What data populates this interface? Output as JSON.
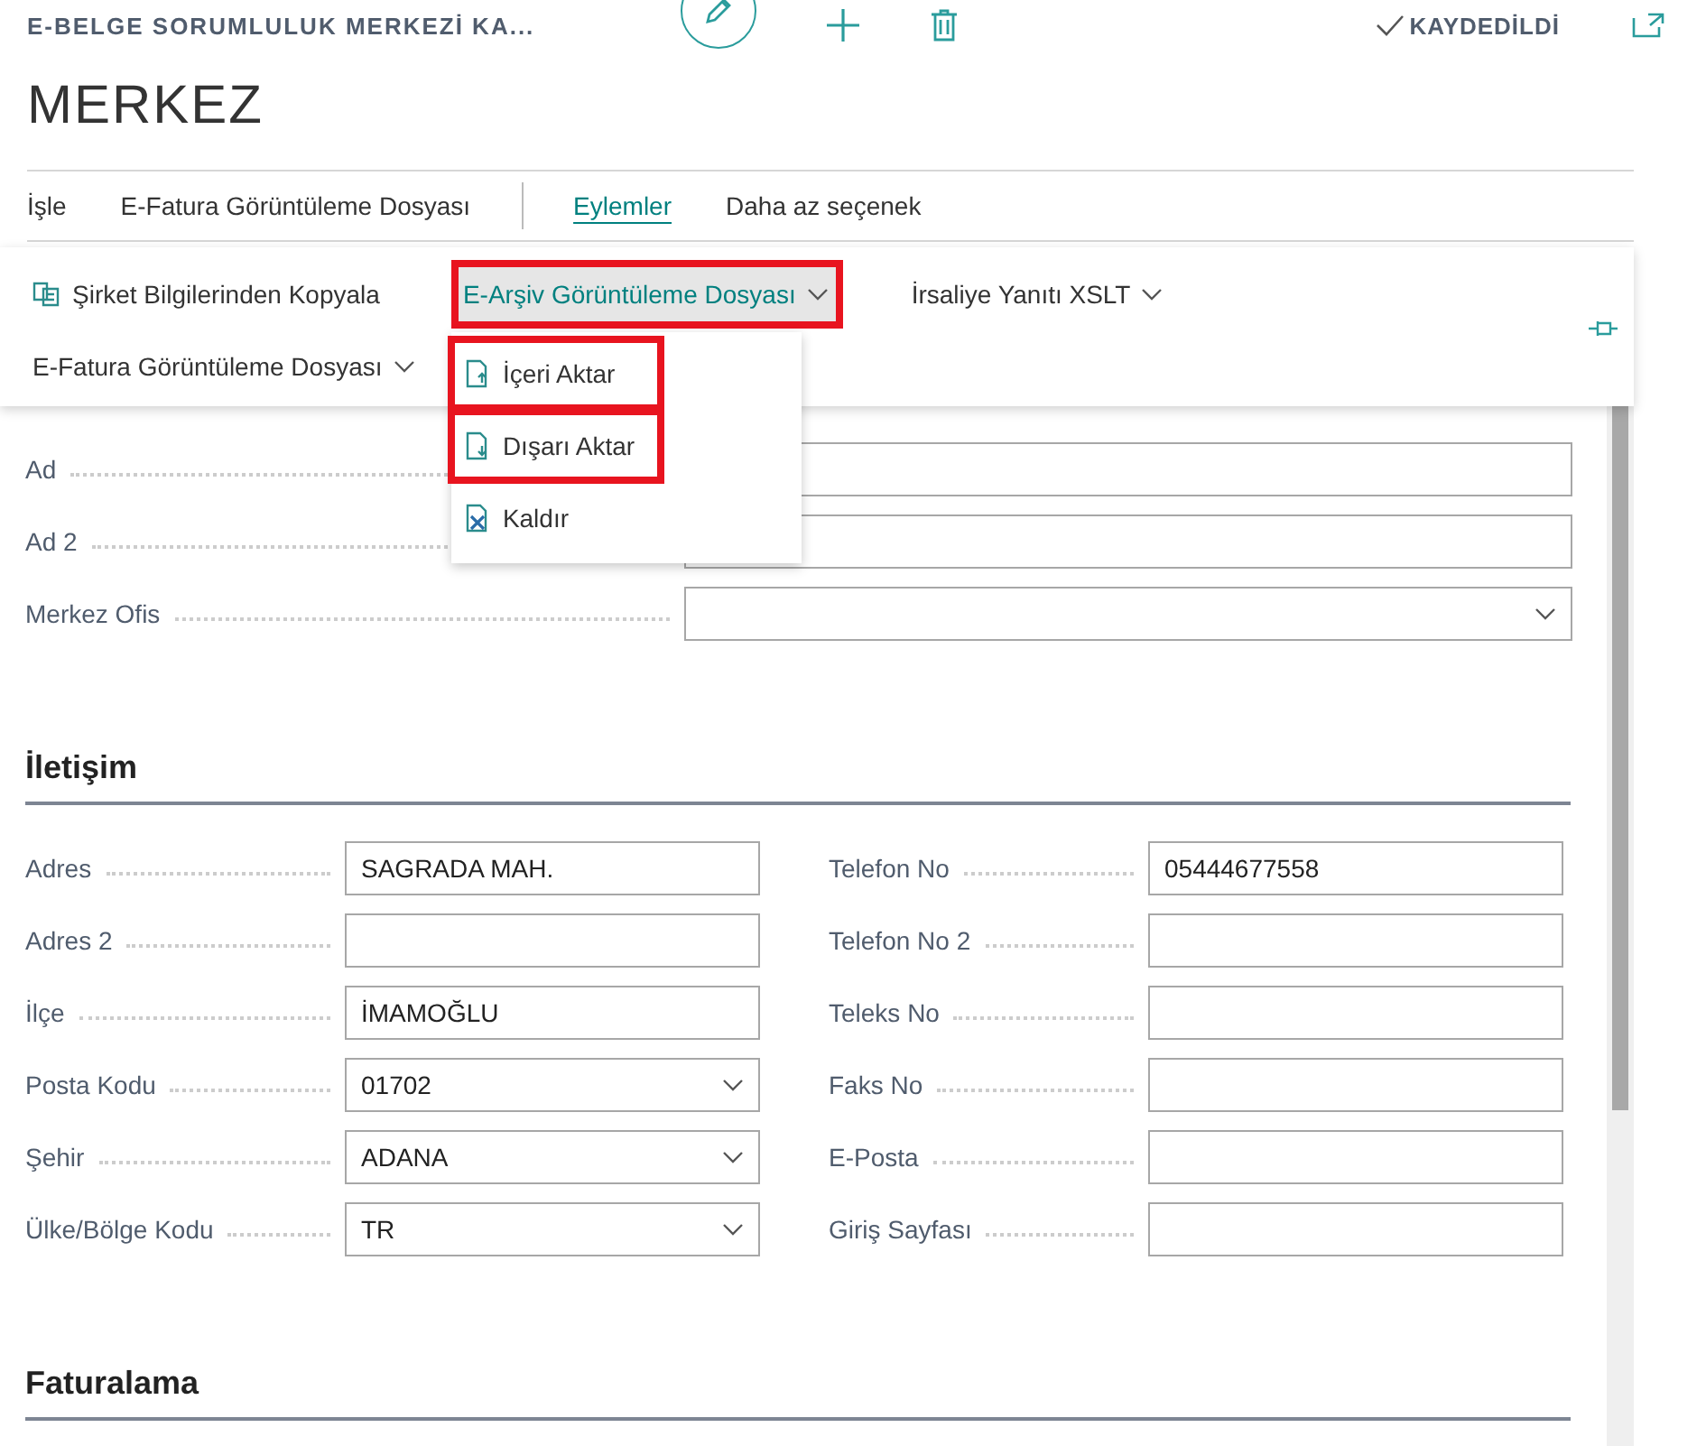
{
  "header": {
    "breadcrumb": "E-BELGE SORUMLULUK MERKEZİ KA...",
    "status": "KAYDEDİLDİ",
    "title": "MERKEZ"
  },
  "promoted_tabs": [
    {
      "label": "İşle",
      "selected": false
    },
    {
      "label": "E-Fatura Görüntüleme Dosyası",
      "selected": false
    }
  ],
  "menu_tabs": [
    {
      "label": "Eylemler",
      "selected": true
    },
    {
      "label": "Daha az seçenek",
      "selected": false
    }
  ],
  "action_rows": [
    [
      {
        "label": "Şirket Bilgilerinden Kopyala",
        "kind": "button",
        "highlighted": false,
        "expanded": false
      },
      {
        "label": "E-Arşiv Görüntüleme Dosyası",
        "kind": "dropdown",
        "highlighted": true,
        "expanded": true
      },
      {
        "label": "İrsaliye Yanıtı XSLT",
        "kind": "dropdown",
        "highlighted": false,
        "expanded": false
      }
    ],
    [
      {
        "label": "E-Fatura Görüntüleme Dosyası",
        "kind": "dropdown",
        "highlighted": false,
        "expanded": false
      }
    ]
  ],
  "dropdown_menu": [
    {
      "label": "İçeri Aktar",
      "kind": "import",
      "highlighted": true
    },
    {
      "label": "Dışarı Aktar",
      "kind": "export",
      "highlighted": true
    },
    {
      "label": "Kaldır",
      "kind": "remove",
      "highlighted": false
    }
  ],
  "general_fields": [
    {
      "label": "Ad",
      "kind": "text"
    },
    {
      "label": "Ad 2",
      "kind": "text"
    },
    {
      "label": "Merkez Ofis",
      "kind": "dropdown"
    }
  ],
  "sections": [
    {
      "title": "İletişim",
      "columns": [
        [
          {
            "label": "Adres",
            "kind": "text",
            "value": "SAGRADA MAH."
          },
          {
            "label": "Adres 2",
            "kind": "text"
          },
          {
            "label": "İlçe",
            "kind": "text",
            "value": "İMAMOĞLU"
          },
          {
            "label": "Posta Kodu",
            "kind": "dropdown",
            "value": "01702"
          },
          {
            "label": "Şehir",
            "kind": "dropdown",
            "value": "ADANA"
          },
          {
            "label": "Ülke/Bölge Kodu",
            "kind": "dropdown",
            "value": "TR"
          }
        ],
        [
          {
            "label": "Telefon No",
            "kind": "text",
            "value": "05444677558"
          },
          {
            "label": "Telefon No 2",
            "kind": "text"
          },
          {
            "label": "Teleks No",
            "kind": "text"
          },
          {
            "label": "Faks No",
            "kind": "text"
          },
          {
            "label": "E-Posta",
            "kind": "text"
          },
          {
            "label": "Giriş Sayfası",
            "kind": "text"
          }
        ]
      ]
    },
    {
      "title": "Faturalama"
    }
  ]
}
